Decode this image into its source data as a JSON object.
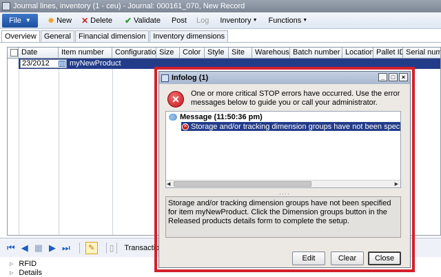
{
  "window": {
    "title": "Journal lines, inventory (1 - ceu) - Journal: 000161_070, New Record"
  },
  "actionpane": {
    "file_label": "File",
    "new_label": "New",
    "delete_label": "Delete",
    "validate_label": "Validate",
    "post_label": "Post",
    "log_label": "Log",
    "inventory_label": "Inventory",
    "functions_label": "Functions"
  },
  "tabs": [
    "Overview",
    "General",
    "Financial dimension",
    "Inventory dimensions"
  ],
  "grid": {
    "columns": [
      "Date",
      "Item number",
      "Configuration",
      "Size",
      "Color",
      "Style",
      "Site",
      "Warehouse",
      "Batch number",
      "Location",
      "Pallet ID",
      "Serial number"
    ],
    "rows": [
      {
        "date": "23/2012",
        "item_number": "myNewProduct"
      }
    ]
  },
  "navbar": {
    "transactions_label": "Transactions"
  },
  "tree": [
    "RFID",
    "Details"
  ],
  "infolog": {
    "title": "Infolog (1)",
    "intro": "One or more critical STOP errors have occurred. Use the error messages below to guide you or call your administrator.",
    "message_header": "Message (11:50:36 pm)",
    "message_row": "Storage and/or tracking dimension groups have not been specified for item m",
    "detail": "Storage and/or tracking dimension groups have not been specified for item myNewProduct. Click the Dimension groups button in the Released products details form to complete the setup.",
    "edit_label": "Edit",
    "clear_label": "Clear",
    "close_label": "Close"
  },
  "colors": {
    "selection": "#233c8a",
    "highlight_frame": "#d4202a",
    "file_button": "#2a5fb0"
  }
}
